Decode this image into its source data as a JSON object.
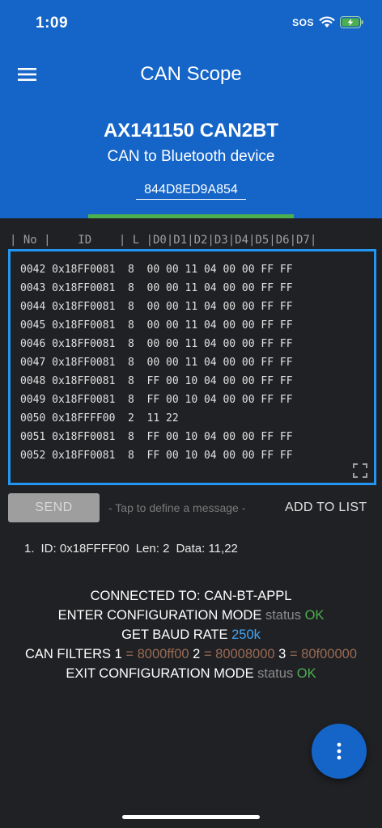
{
  "status_bar": {
    "time": "1:09",
    "sos": "SOS",
    "wifi_icon": "wifi-icon",
    "battery_icon": "battery-charging-icon",
    "battery_color": "#4caf50"
  },
  "app_bar": {
    "menu_icon": "hamburger-menu-icon",
    "title": "CAN Scope",
    "color": "#1565c8"
  },
  "device": {
    "name": "AX141150 CAN2BT",
    "description": "CAN to Bluetooth device",
    "mac": "844D8ED9A854",
    "connection_indicator_color": "#4caf50"
  },
  "frames": {
    "column_header": "| No |    ID    | L |D0|D1|D2|D3|D4|D5|D6|D7|",
    "rows": [
      "0042 0x18FF0081  8  00 00 11 04 00 00 FF FF",
      "0043 0x18FF0081  8  00 00 11 04 00 00 FF FF",
      "0044 0x18FF0081  8  00 00 11 04 00 00 FF FF",
      "0045 0x18FF0081  8  00 00 11 04 00 00 FF FF",
      "0046 0x18FF0081  8  00 00 11 04 00 00 FF FF",
      "0047 0x18FF0081  8  00 00 11 04 00 00 FF FF",
      "0048 0x18FF0081  8  FF 00 10 04 00 00 FF FF",
      "0049 0x18FF0081  8  FF 00 10 04 00 00 FF FF",
      "0050 0x18FFFF00  2  11 22",
      "0051 0x18FF0081  8  FF 00 10 04 00 00 FF FF",
      "0052 0x18FF0081  8  FF 00 10 04 00 00 FF FF"
    ],
    "border_color": "#2196f3",
    "expand_icon": "fullscreen-icon"
  },
  "actions": {
    "send_label": "SEND",
    "tap_hint": "- Tap to define a message -",
    "add_label": "ADD TO LIST"
  },
  "message_list": [
    {
      "index": "1.",
      "id": "ID: 0x18FFFF00",
      "len": "Len: 2",
      "data": "Data: 11,22"
    }
  ],
  "log": {
    "connected_label": "CONNECTED TO:",
    "connected_value": "CAN-BT-APPL",
    "enter_config_label": "ENTER CONFIGURATION MODE",
    "enter_config_status_label": "status",
    "enter_config_status": "OK",
    "baud_label": "GET BAUD RATE",
    "baud_value": "250k",
    "filters_label": "CAN FILTERS",
    "filter1_num": "1",
    "filter1_value": "= 8000ff00",
    "filter2_num": "2",
    "filter2_value": "= 80008000",
    "filter3_num": "3",
    "filter3_value": "= 80f00000",
    "exit_config_label": "EXIT CONFIGURATION MODE",
    "exit_config_status_label": "status",
    "exit_config_status": "OK"
  },
  "fab": {
    "icon": "more-vertical-icon"
  }
}
